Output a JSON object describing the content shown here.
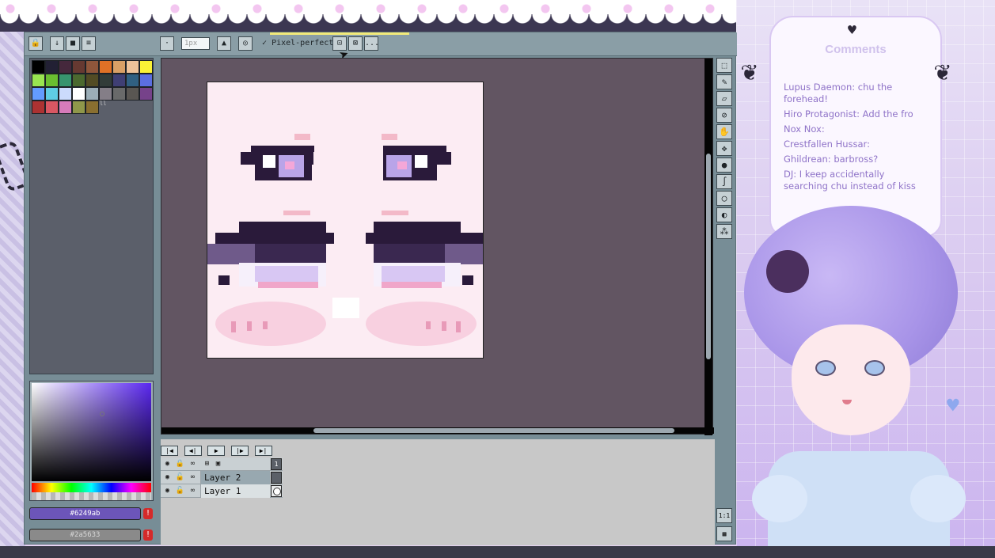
{
  "toolbar": {
    "brush_size_placeholder": "1px",
    "pixel_perfect_label": "Pixel-perfect",
    "more_label": "..."
  },
  "palette": {
    "colors": [
      "#000000",
      "#222034",
      "#45283c",
      "#663931",
      "#8f563b",
      "#df7126",
      "#d9a066",
      "#eec39a",
      "#fbf236",
      "#99e550",
      "#6abe30",
      "#37946e",
      "#4b692f",
      "#524b24",
      "#323c39",
      "#3f3f74",
      "#306082",
      "#5b6ee1",
      "#639bff",
      "#5fcde4",
      "#cbdbfc",
      "#ffffff",
      "#9badb7",
      "#847e87",
      "#696a6a",
      "#595652",
      "#76428a",
      "#ac3232",
      "#d95763",
      "#d77bba",
      "#8f974a",
      "#8a6f30"
    ],
    "index_label": "ll"
  },
  "colors": {
    "foreground_hex": "#6249ab",
    "background_hex": "#2a5633",
    "warn_icon": "!"
  },
  "timeline": {
    "buttons": [
      "|◀",
      "◀|",
      "▶",
      "|▶",
      "▶|"
    ],
    "frame_number": "1",
    "layers": [
      {
        "name": "Layer 2",
        "selected": true
      },
      {
        "name": "Layer 1",
        "selected": false
      }
    ]
  },
  "zoom": {
    "one_to_one": "1:1"
  },
  "comments": {
    "title": "Comments",
    "items": [
      {
        "author": "Lupus Daemon:",
        "text": "chu the forehead!"
      },
      {
        "author": "Hiro Protagonist:",
        "text": "Add the fro"
      },
      {
        "author": "Nox Nox:",
        "text": ""
      },
      {
        "author": "Crestfallen Hussar:",
        "text": ""
      },
      {
        "author": "Ghildrean:",
        "text": "barbross?"
      },
      {
        "author": "DJ:",
        "text": "I keep accidentally searching chu instead of kiss"
      }
    ]
  }
}
